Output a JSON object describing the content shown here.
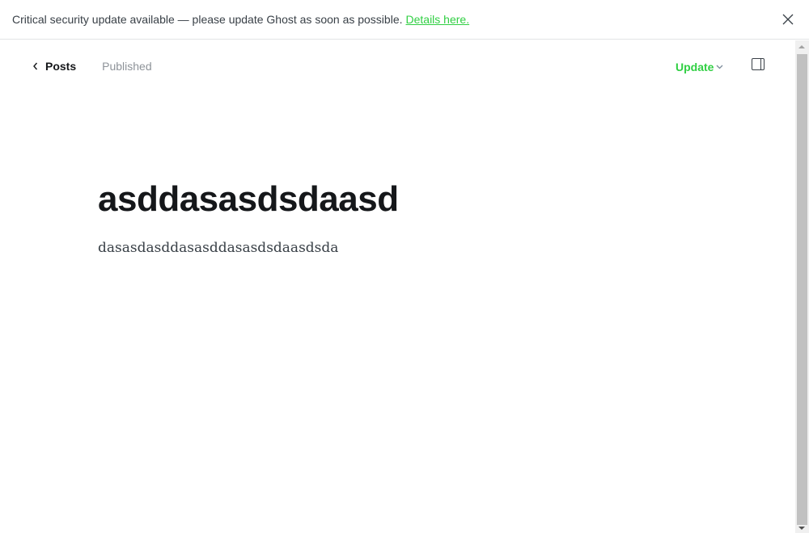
{
  "banner": {
    "message": "Critical security update available — please update Ghost as soon as possible.",
    "link": "Details here."
  },
  "nav": {
    "back_label": "Posts",
    "status": "Published"
  },
  "actions": {
    "update_label": "Update"
  },
  "editor": {
    "title": "asddasasdsdaasd",
    "body": "dasasdasddasasddasasdsdaasdsda"
  },
  "colors": {
    "accent": "#30cf43"
  }
}
